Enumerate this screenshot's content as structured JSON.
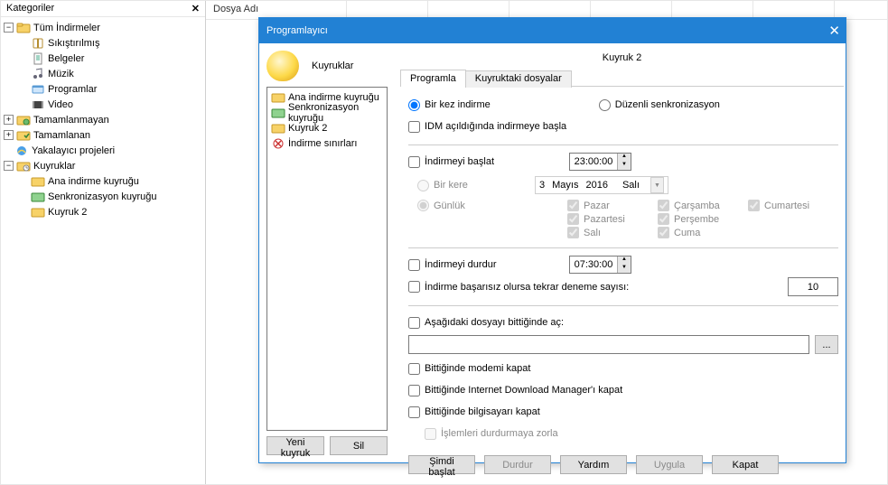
{
  "sidebar": {
    "title": "Kategoriler",
    "root": "Tüm İndirmeler",
    "cats": [
      "Sıkıştırılmış",
      "Belgeler",
      "Müzik",
      "Programlar",
      "Video"
    ],
    "groups": [
      "Tamamlanmayan",
      "Tamamlanan",
      "Yakalayıcı projeleri"
    ],
    "queues_root": "Kuyruklar",
    "queues": [
      "Ana indirme kuyruğu",
      "Senkronizasyon kuyruğu",
      "Kuyruk 2"
    ]
  },
  "listHeader": "Dosya Adı",
  "dialog": {
    "title": "Programlayıcı",
    "left_title": "Kuyruklar",
    "queues": [
      "Ana indirme kuyruğu",
      "Senkronizasyon kuyruğu",
      "Kuyruk 2",
      "İndirme sınırları"
    ],
    "new_btn": "Yeni kuyruk",
    "del_btn": "Sil",
    "selected": "Kuyruk 2",
    "tab1": "Programla",
    "tab2": "Kuyruktaki dosyalar",
    "once": "Bir kez indirme",
    "periodic": "Düzenli senkronizasyon",
    "start_on_open": "IDM açıldığında indirmeye başla",
    "start_dl": "İndirmeyi başlat",
    "start_time": "23:00:00",
    "one_time": "Bir kere",
    "date_d": "3",
    "date_m": "Mayıs",
    "date_y": "2016",
    "date_dow": "Salı",
    "daily": "Günlük",
    "days": {
      "sun": "Pazar",
      "mon": "Pazartesi",
      "tue": "Salı",
      "wed": "Çarşamba",
      "thu": "Perşembe",
      "fri": "Cuma",
      "sat": "Cumartesi"
    },
    "stop_dl": "İndirmeyi durdur",
    "stop_time": "07:30:00",
    "retry": "İndirme başarısız olursa tekrar deneme sayısı:",
    "retry_n": "10",
    "open_file": "Aşağıdaki dosyayı bittiğinde aç:",
    "hangup": "Bittiğinde modemi kapat",
    "exit": "Bittiğinde Internet Download Manager'ı kapat",
    "shutdown": "Bittiğinde bilgisayarı kapat",
    "force": "İşlemleri durdurmaya zorla",
    "btns": {
      "start": "Şimdi başlat",
      "stop": "Durdur",
      "help": "Yardım",
      "apply": "Uygula",
      "close": "Kapat"
    }
  },
  "chart_data": null
}
